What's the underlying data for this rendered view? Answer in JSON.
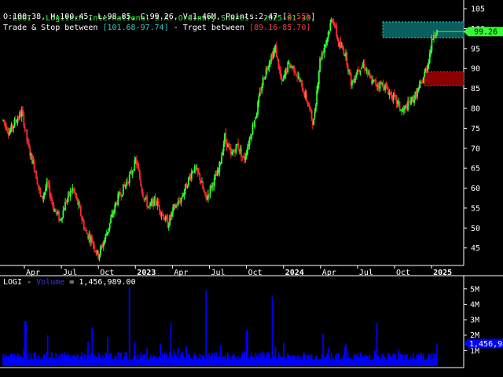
{
  "header": {
    "line1": "LOGI - Logitech International S.A. Ordinary Shares - 2025-01-30,",
    "line2_ohlc": "O:100.38, H:100.45, L:98.85, C:99.26, V:1.46M, Points:2.47 ",
    "line2_pct": "2.55%",
    "line3_prefix": "Trade & Stop between ",
    "line3_trade": "[101.68-97.74]",
    "line3_mid": " - Trget between ",
    "line3_target": "[89.16-85.70]"
  },
  "volume_header": {
    "prefix": "LOGI - ",
    "label": "Volume",
    "suffix": " = 1,456,989.00"
  },
  "colors": {
    "up": "#33ff33",
    "down": "#ff2a2a",
    "volume": "#0000ff",
    "trade_zone": "#0b5e5e",
    "target_zone": "#8b0000",
    "grid_text": "#ffffff",
    "axis": "#ffffff",
    "last_price_tag": "#33ff33",
    "last_volume_tag": "#0000ff"
  },
  "chart_data": {
    "type": "candlestick",
    "ticker": "LOGI",
    "y_ticks": [
      45,
      50,
      55,
      60,
      65,
      70,
      75,
      80,
      85,
      90,
      95,
      100,
      105
    ],
    "x_ticks": [
      "Apr",
      "Jul",
      "Oct",
      "2023",
      "Apr",
      "Jul",
      "Oct",
      "2024",
      "Apr",
      "Jul",
      "Oct",
      "2025"
    ],
    "x_tick_bold": [
      false,
      false,
      false,
      true,
      false,
      false,
      false,
      true,
      false,
      false,
      false,
      true
    ],
    "last_price_label": "99.26",
    "trade_zone": [
      97.74,
      101.68
    ],
    "target_zone": [
      85.7,
      89.16
    ],
    "price_path": [
      [
        0,
        77
      ],
      [
        2,
        74
      ],
      [
        4,
        77
      ],
      [
        6,
        79
      ],
      [
        8,
        70
      ],
      [
        10,
        65
      ],
      [
        12,
        57
      ],
      [
        14,
        61
      ],
      [
        16,
        55
      ],
      [
        18,
        52
      ],
      [
        20,
        57
      ],
      [
        22,
        60
      ],
      [
        24,
        55
      ],
      [
        26,
        49
      ],
      [
        28,
        47
      ],
      [
        30,
        43
      ],
      [
        32,
        47
      ],
      [
        34,
        52
      ],
      [
        36,
        57
      ],
      [
        38,
        60
      ],
      [
        40,
        63
      ],
      [
        42,
        67
      ],
      [
        44,
        59
      ],
      [
        46,
        55
      ],
      [
        48,
        57
      ],
      [
        50,
        54
      ],
      [
        52,
        51
      ],
      [
        54,
        55
      ],
      [
        56,
        57
      ],
      [
        58,
        61
      ],
      [
        60,
        65
      ],
      [
        62,
        63
      ],
      [
        64,
        57
      ],
      [
        66,
        61
      ],
      [
        68,
        64
      ],
      [
        70,
        73
      ],
      [
        72,
        68
      ],
      [
        74,
        71
      ],
      [
        76,
        67
      ],
      [
        78,
        73
      ],
      [
        80,
        79
      ],
      [
        82,
        87
      ],
      [
        84,
        92
      ],
      [
        86,
        95
      ],
      [
        88,
        86
      ],
      [
        90,
        91
      ],
      [
        92,
        90
      ],
      [
        94,
        86
      ],
      [
        96,
        82
      ],
      [
        98,
        76
      ],
      [
        100,
        92
      ],
      [
        102,
        97
      ],
      [
        104,
        103
      ],
      [
        106,
        96
      ],
      [
        108,
        94
      ],
      [
        110,
        86
      ],
      [
        112,
        90
      ],
      [
        114,
        91
      ],
      [
        116,
        87
      ],
      [
        118,
        86
      ],
      [
        120,
        86
      ],
      [
        122,
        84
      ],
      [
        124,
        82
      ],
      [
        126,
        79
      ],
      [
        128,
        81
      ],
      [
        130,
        83
      ],
      [
        132,
        86
      ],
      [
        134,
        91
      ],
      [
        136,
        99
      ],
      [
        137,
        99.26
      ]
    ],
    "y_ticks_volume": [
      "1M",
      "2M",
      "3M",
      "4M",
      "5M"
    ],
    "y_ticks_volume_values": [
      1,
      2,
      3,
      4,
      5
    ],
    "volume_ylim": [
      0,
      5.6
    ],
    "volume_spikes": [
      [
        40,
        5.1
      ],
      [
        64,
        4.9
      ],
      [
        85,
        4.5
      ],
      [
        7,
        2.9
      ],
      [
        53,
        2.8
      ],
      [
        118,
        2.8
      ],
      [
        28,
        2.5
      ],
      [
        77,
        2.3
      ],
      [
        101,
        2.1
      ],
      [
        14,
        2.0
      ],
      [
        33,
        1.9
      ],
      [
        137,
        1.46
      ]
    ],
    "last_volume_label": "1,456,989",
    "ylim": [
      41,
      106
    ]
  }
}
